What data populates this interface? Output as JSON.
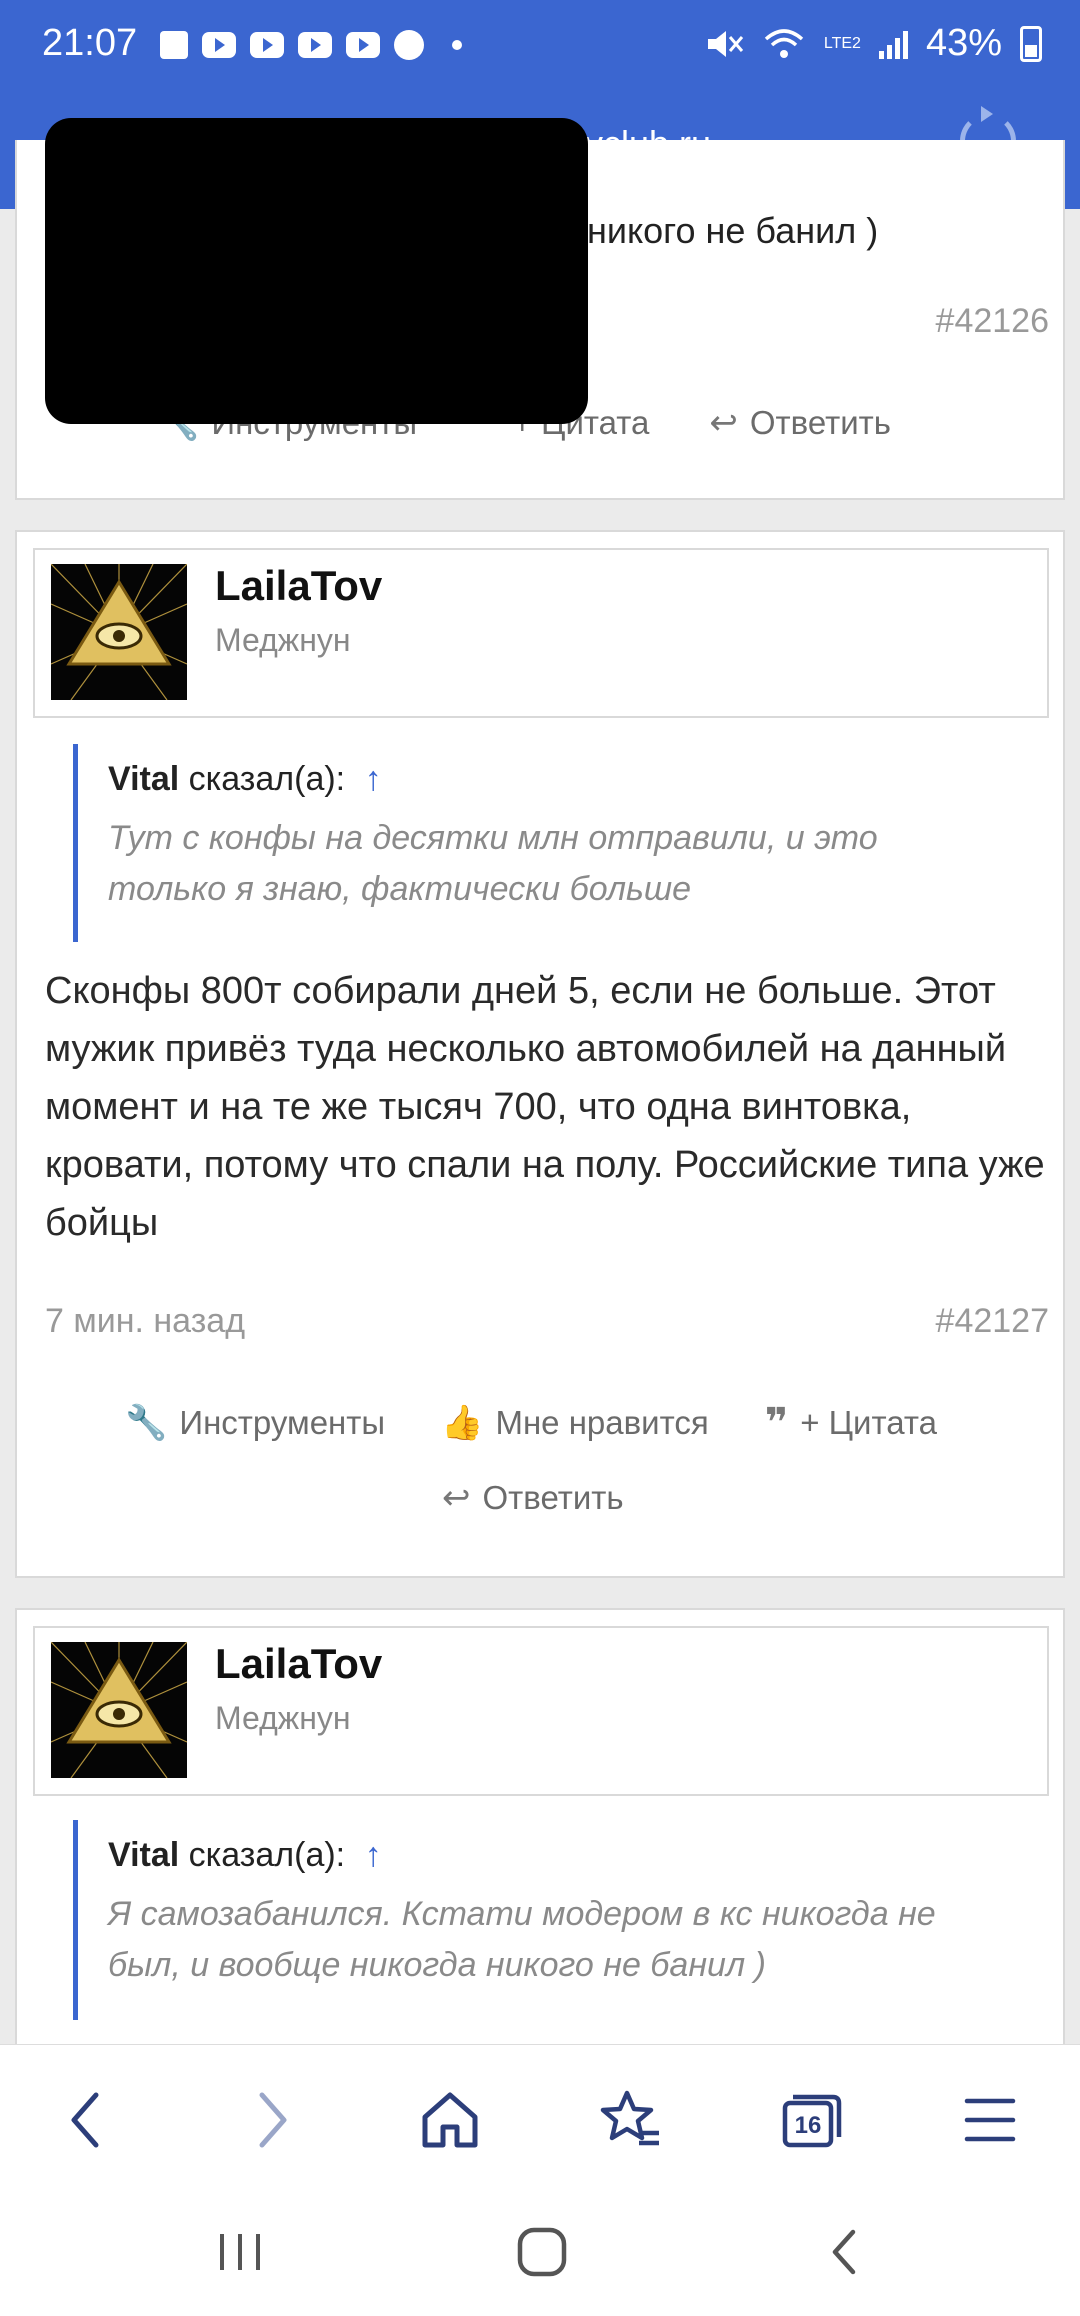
{
  "status_bar": {
    "time": "21:07",
    "network": "LTE2",
    "battery": "43%"
  },
  "browser": {
    "url_fragment": "vclub.ru"
  },
  "colors": {
    "accent": "#3b66d0",
    "muted": "#999999",
    "quote_text": "#8a8a8a"
  },
  "posts": [
    {
      "fragment_text": "никого не банил )",
      "number": "#42126",
      "actions": {
        "tools": "Инструменты",
        "quote": "+ Цитата",
        "reply": "Ответить"
      }
    },
    {
      "author": "LailaTov",
      "user_title": "Меджнун",
      "quote": {
        "author": "Vital",
        "said": "сказал(а):",
        "arrow": "↑",
        "text": "Тут с конфы на десятки млн отправили, и это только я знаю, фактически больше"
      },
      "text": "Сконфы 800т собирали дней 5, если не больше. Этот мужик привёз туда несколько автомобилей на данный момент и на те же тысяч 700, что одна винтовка, кровати, потому что спали на полу. Российские типа уже бойцы",
      "time": "7 мин. назад",
      "number": "#42127",
      "actions": {
        "tools": "Инструменты",
        "like": "Мне нравится",
        "quote": "+ Цитата",
        "reply": "Ответить"
      }
    },
    {
      "author": "LailaTov",
      "user_title": "Меджнун",
      "quote": {
        "author": "Vital",
        "said": "сказал(а):",
        "arrow": "↑",
        "text": "Я самозабанился. Кстати модером в кс никогда не был, и вообще никогда никого не банил )"
      }
    }
  ],
  "bottom_nav": {
    "tab_count": "16",
    "icons": [
      "back-icon",
      "forward-icon",
      "home-icon",
      "bookmarks-icon",
      "tabs-icon",
      "menu-icon"
    ]
  }
}
